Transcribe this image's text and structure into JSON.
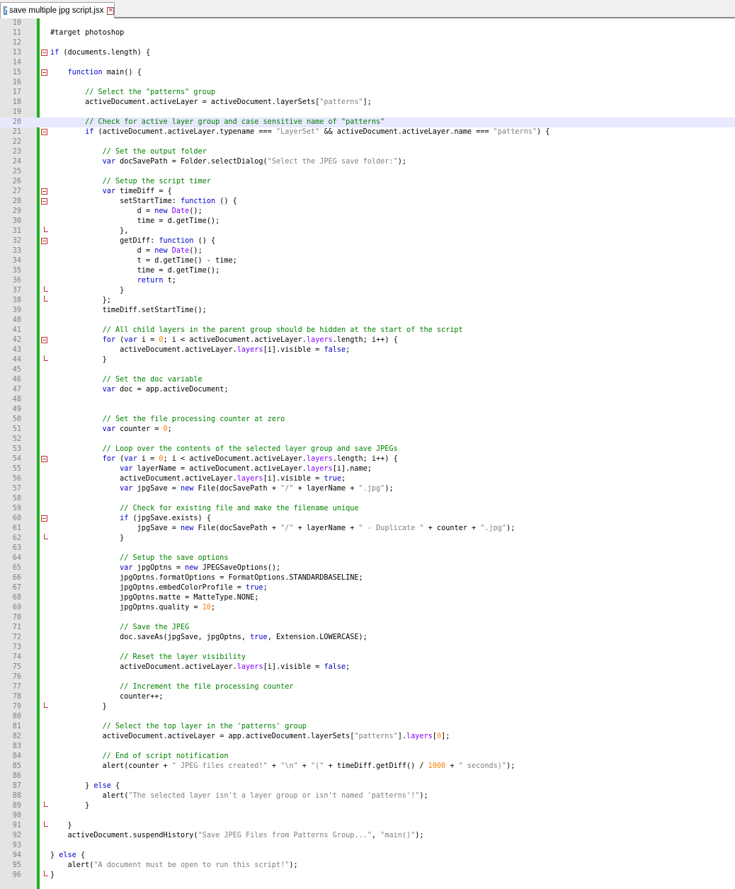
{
  "tab": {
    "title": "save multiple jpg script.jsx",
    "close_label": "✕"
  },
  "colors": {
    "keyword": "#0000c8",
    "string": "#808080",
    "comment": "#008000",
    "number": "#ff8000",
    "property": "#8000ff",
    "change_bar": "#20b020",
    "fold_marker": "#c03030"
  },
  "editor": {
    "current_line": 20,
    "lines": [
      {
        "n": "10",
        "t": ""
      },
      {
        "n": "11",
        "t": "#target photoshop"
      },
      {
        "n": "12",
        "t": ""
      },
      {
        "n": "13",
        "t": "if (documents.length) {",
        "fold": "open"
      },
      {
        "n": "14",
        "t": ""
      },
      {
        "n": "15",
        "t": "    function main() {",
        "fold": "open"
      },
      {
        "n": "16",
        "t": ""
      },
      {
        "n": "17",
        "t": "        // Select the \"patterns\" group"
      },
      {
        "n": "18",
        "t": "        activeDocument.activeLayer = activeDocument.layerSets[\"patterns\"];"
      },
      {
        "n": "19",
        "t": ""
      },
      {
        "n": "20",
        "t": "        // Check for active layer group and case sensitive name of \"patterns\""
      },
      {
        "n": "21",
        "t": "        if (activeDocument.activeLayer.typename === \"LayerSet\" && activeDocument.activeLayer.name === \"patterns\") {",
        "fold": "open"
      },
      {
        "n": "22",
        "t": ""
      },
      {
        "n": "23",
        "t": "            // Set the output folder"
      },
      {
        "n": "24",
        "t": "            var docSavePath = Folder.selectDialog(\"Select the JPEG save folder:\");"
      },
      {
        "n": "25",
        "t": ""
      },
      {
        "n": "26",
        "t": "            // Setup the script timer"
      },
      {
        "n": "27",
        "t": "            var timeDiff = {",
        "fold": "open"
      },
      {
        "n": "28",
        "t": "                setStartTime: function () {",
        "fold": "open"
      },
      {
        "n": "29",
        "t": "                    d = new Date();"
      },
      {
        "n": "30",
        "t": "                    time = d.getTime();"
      },
      {
        "n": "31",
        "t": "                },",
        "fold": "end"
      },
      {
        "n": "32",
        "t": "                getDiff: function () {",
        "fold": "open"
      },
      {
        "n": "33",
        "t": "                    d = new Date();"
      },
      {
        "n": "34",
        "t": "                    t = d.getTime() - time;"
      },
      {
        "n": "35",
        "t": "                    time = d.getTime();"
      },
      {
        "n": "36",
        "t": "                    return t;"
      },
      {
        "n": "37",
        "t": "                }",
        "fold": "end"
      },
      {
        "n": "38",
        "t": "            };",
        "fold": "end"
      },
      {
        "n": "39",
        "t": "            timeDiff.setStartTime();"
      },
      {
        "n": "40",
        "t": ""
      },
      {
        "n": "41",
        "t": "            // All child layers in the parent group should be hidden at the start of the script"
      },
      {
        "n": "42",
        "t": "            for (var i = 0; i < activeDocument.activeLayer.layers.length; i++) {",
        "fold": "open"
      },
      {
        "n": "43",
        "t": "                activeDocument.activeLayer.layers[i].visible = false;"
      },
      {
        "n": "44",
        "t": "            }",
        "fold": "end"
      },
      {
        "n": "45",
        "t": ""
      },
      {
        "n": "46",
        "t": "            // Set the doc variable"
      },
      {
        "n": "47",
        "t": "            var doc = app.activeDocument;"
      },
      {
        "n": "48",
        "t": ""
      },
      {
        "n": "49",
        "t": ""
      },
      {
        "n": "50",
        "t": "            // Set the file processing counter at zero"
      },
      {
        "n": "51",
        "t": "            var counter = 0;"
      },
      {
        "n": "52",
        "t": ""
      },
      {
        "n": "53",
        "t": "            // Loop over the contents of the selected layer group and save JPEGs"
      },
      {
        "n": "54",
        "t": "            for (var i = 0; i < activeDocument.activeLayer.layers.length; i++) {",
        "fold": "open"
      },
      {
        "n": "55",
        "t": "                var layerName = activeDocument.activeLayer.layers[i].name;"
      },
      {
        "n": "56",
        "t": "                activeDocument.activeLayer.layers[i].visible = true;"
      },
      {
        "n": "57",
        "t": "                var jpgSave = new File(docSavePath + \"/\" + layerName + \".jpg\");"
      },
      {
        "n": "58",
        "t": ""
      },
      {
        "n": "59",
        "t": "                // Check for existing file and make the filename unique"
      },
      {
        "n": "60",
        "t": "                if (jpgSave.exists) {",
        "fold": "open"
      },
      {
        "n": "61",
        "t": "                    jpgSave = new File(docSavePath + \"/\" + layerName + \" - Duplicate \" + counter + \".jpg\");"
      },
      {
        "n": "62",
        "t": "                }",
        "fold": "end"
      },
      {
        "n": "63",
        "t": ""
      },
      {
        "n": "64",
        "t": "                // Setup the save options"
      },
      {
        "n": "65",
        "t": "                var jpgOptns = new JPEGSaveOptions();"
      },
      {
        "n": "66",
        "t": "                jpgOptns.formatOptions = FormatOptions.STANDARDBASELINE;"
      },
      {
        "n": "67",
        "t": "                jpgOptns.embedColorProfile = true;"
      },
      {
        "n": "68",
        "t": "                jpgOptns.matte = MatteType.NONE;"
      },
      {
        "n": "69",
        "t": "                jpgOptns.quality = 10;"
      },
      {
        "n": "70",
        "t": ""
      },
      {
        "n": "71",
        "t": "                // Save the JPEG"
      },
      {
        "n": "72",
        "t": "                doc.saveAs(jpgSave, jpgOptns, true, Extension.LOWERCASE);"
      },
      {
        "n": "73",
        "t": ""
      },
      {
        "n": "74",
        "t": "                // Reset the layer visibility"
      },
      {
        "n": "75",
        "t": "                activeDocument.activeLayer.layers[i].visible = false;"
      },
      {
        "n": "76",
        "t": ""
      },
      {
        "n": "77",
        "t": "                // Increment the file processing counter"
      },
      {
        "n": "78",
        "t": "                counter++;"
      },
      {
        "n": "79",
        "t": "            }",
        "fold": "end"
      },
      {
        "n": "80",
        "t": ""
      },
      {
        "n": "81",
        "t": "            // Select the top layer in the 'patterns' group"
      },
      {
        "n": "82",
        "t": "            activeDocument.activeLayer = app.activeDocument.layerSets[\"patterns\"].layers[0];"
      },
      {
        "n": "83",
        "t": ""
      },
      {
        "n": "84",
        "t": "            // End of script notification"
      },
      {
        "n": "85",
        "t": "            alert(counter + \" JPEG files created!\" + \"\\n\" + \"(\" + timeDiff.getDiff() / 1000 + \" seconds)\");"
      },
      {
        "n": "86",
        "t": ""
      },
      {
        "n": "87",
        "t": "        } else {"
      },
      {
        "n": "88",
        "t": "            alert(\"The selected layer isn't a layer group or isn't named 'patterns'!\");"
      },
      {
        "n": "89",
        "t": "        }",
        "fold": "end"
      },
      {
        "n": "90",
        "t": ""
      },
      {
        "n": "91",
        "t": "    }",
        "fold": "end"
      },
      {
        "n": "92",
        "t": "    activeDocument.suspendHistory(\"Save JPEG Files from Patterns Group...\", \"main()\");"
      },
      {
        "n": "93",
        "t": ""
      },
      {
        "n": "94",
        "t": "} else {"
      },
      {
        "n": "95",
        "t": "    alert(\"A document must be open to run this script!\");"
      },
      {
        "n": "96",
        "t": "}",
        "fold": "end"
      }
    ]
  }
}
